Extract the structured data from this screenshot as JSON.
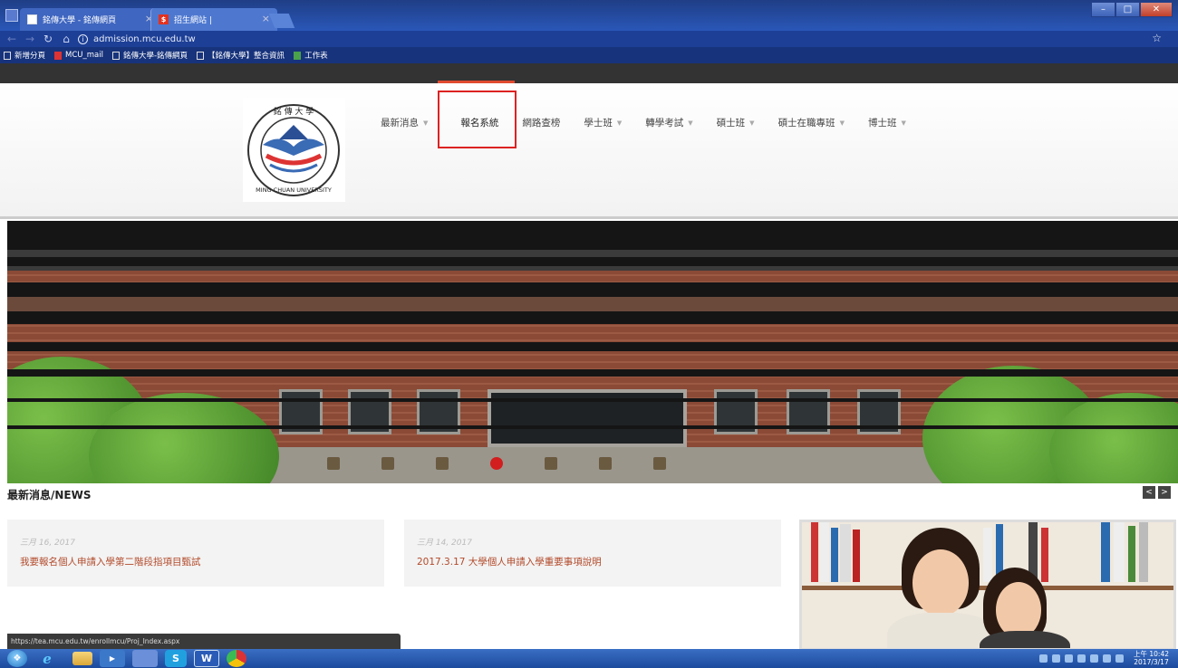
{
  "browser": {
    "tabs": [
      {
        "label": "銘傳大學 - 銘傳網頁"
      },
      {
        "label": "招生網站 |"
      }
    ],
    "tab_close": "×",
    "tab2_favicon": "$",
    "url": "admission.mcu.edu.tw",
    "info_glyph": "i",
    "bookmarks": [
      {
        "label": "新增分頁"
      },
      {
        "label": "MCU_mail"
      },
      {
        "label": "銘傳大學-銘傳網頁"
      },
      {
        "label": "【銘傳大學】整合資訊"
      },
      {
        "label": "工作表"
      }
    ],
    "status_url": "https://tea.mcu.edu.tw/enrollmcu/Proj_Index.aspx"
  },
  "site": {
    "logo": {
      "text_top": "銘 傳 大 學",
      "text_bottom": "MING CHUAN UNIVERSITY"
    },
    "nav": [
      {
        "label": "最新消息",
        "dropdown": true
      },
      {
        "label": "報名系統",
        "dropdown": false,
        "highlighted": true
      },
      {
        "label": "網路查榜",
        "dropdown": false
      },
      {
        "label": "學士班",
        "dropdown": true
      },
      {
        "label": "轉學考試",
        "dropdown": true
      },
      {
        "label": "碩士班",
        "dropdown": true
      },
      {
        "label": "碩士在職專班",
        "dropdown": true
      },
      {
        "label": "博士班",
        "dropdown": true
      }
    ],
    "news_heading": "最新消息/NEWS",
    "news_prev": "<",
    "news_next": ">",
    "news": [
      {
        "date": "三月 16, 2017",
        "title": "我要報名個人申請入學第二階段指項目甄試"
      },
      {
        "date": "三月 14, 2017",
        "title": "2017.3.17 大學個人申請入學重要事項說明"
      }
    ]
  },
  "taskbar": {
    "clock_time": "上午 10:42",
    "clock_date": "2017/3/17"
  },
  "colors": {
    "accent": "#e04a30",
    "highlight_box": "#dd2222",
    "news_title": "#b24a2a"
  }
}
